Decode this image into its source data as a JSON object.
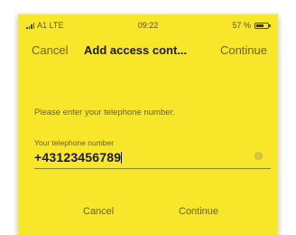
{
  "status_bar": {
    "carrier": "A1 LTE",
    "time": "09:22",
    "battery": "57 %",
    "battery_level": 0.57
  },
  "nav": {
    "cancel_label": "Cancel",
    "title": "Add access cont...",
    "continue_label": "Continue"
  },
  "form": {
    "prompt": "Please enter your telephone number.",
    "phone_label": "Your telephone number",
    "phone_value": "+43123456789"
  },
  "footer": {
    "cancel_label": "Cancel",
    "continue_label": "Continue"
  },
  "colors": {
    "background": "#f7e62a",
    "title_text": "#1a1a10",
    "secondary_text": "#6a6418"
  }
}
